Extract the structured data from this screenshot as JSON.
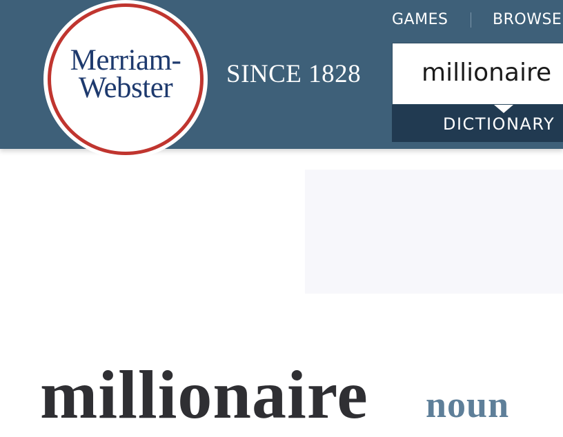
{
  "header": {
    "logo": {
      "line1": "Merriam-",
      "line2": "Webster"
    },
    "tagline": "SINCE 1828",
    "nav": {
      "games": "GAMES",
      "browse": "BROWSE"
    },
    "search": {
      "value": "millionaire"
    },
    "dictionary_tab": "DICTIONARY"
  },
  "entry": {
    "headword": "millionaire",
    "part_of_speech": "noun"
  },
  "colors": {
    "header_bg": "#3e6079",
    "tab_bg": "#213a51",
    "logo_ring": "#c0352f",
    "logo_text": "#1e3a6e",
    "pos_text": "#5e7f99"
  }
}
